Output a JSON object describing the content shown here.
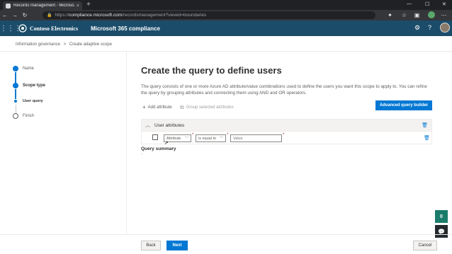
{
  "browser": {
    "tab_title": "Records management - Microso...",
    "url_prefix": "https://",
    "url_host": "compliance.microsoft.com",
    "url_path": "/recordsmanagement?viewid=boundaries",
    "new_tab": "+",
    "tab_close": "×",
    "minimize": "—",
    "maximize": "☐",
    "close": "✕",
    "back": "←",
    "forward": "→",
    "refresh": "↻",
    "lock": "🔒"
  },
  "header": {
    "org_name": "Contoso Electronics",
    "app_name": "Microsoft 365 compliance",
    "waffle": "⋮⋮⋮",
    "settings": "⚙",
    "help": "?"
  },
  "breadcrumb": {
    "items": [
      "Information governance",
      "Create adaptive scope"
    ],
    "separator": ">"
  },
  "steps": [
    {
      "label": "Name",
      "state": "done"
    },
    {
      "label": "Scope type",
      "state": "current"
    },
    {
      "label": "User query",
      "state": "substep"
    },
    {
      "label": "Finish",
      "state": "pending"
    }
  ],
  "main": {
    "heading": "Create the query to define users",
    "description": "The query consists of one or more Azure AD attribute/value combinations used to define the users you want this scope to apply to. You can refine the query by grouping attributes and connecting them using AND and OR operators.",
    "add_attribute": "Add attribute",
    "group_selected": "Group selected attributes",
    "advanced_builder": "Advanced query builder",
    "group_title": "User attributes",
    "attribute_select": "Attribute",
    "operator_select": "is equal to",
    "value_placeholder": "Value",
    "required_mark": "*",
    "query_summary_label": "Query summary",
    "query_summary_value": "-"
  },
  "footer": {
    "back": "Back",
    "next": "Next",
    "cancel": "Cancel"
  },
  "floating": {
    "help_badge": "0",
    "chat_icon": "💬"
  },
  "colors": {
    "app_header": "#1b4d6b",
    "accent": "#0078d4",
    "help_badge": "#1b7c6b"
  }
}
